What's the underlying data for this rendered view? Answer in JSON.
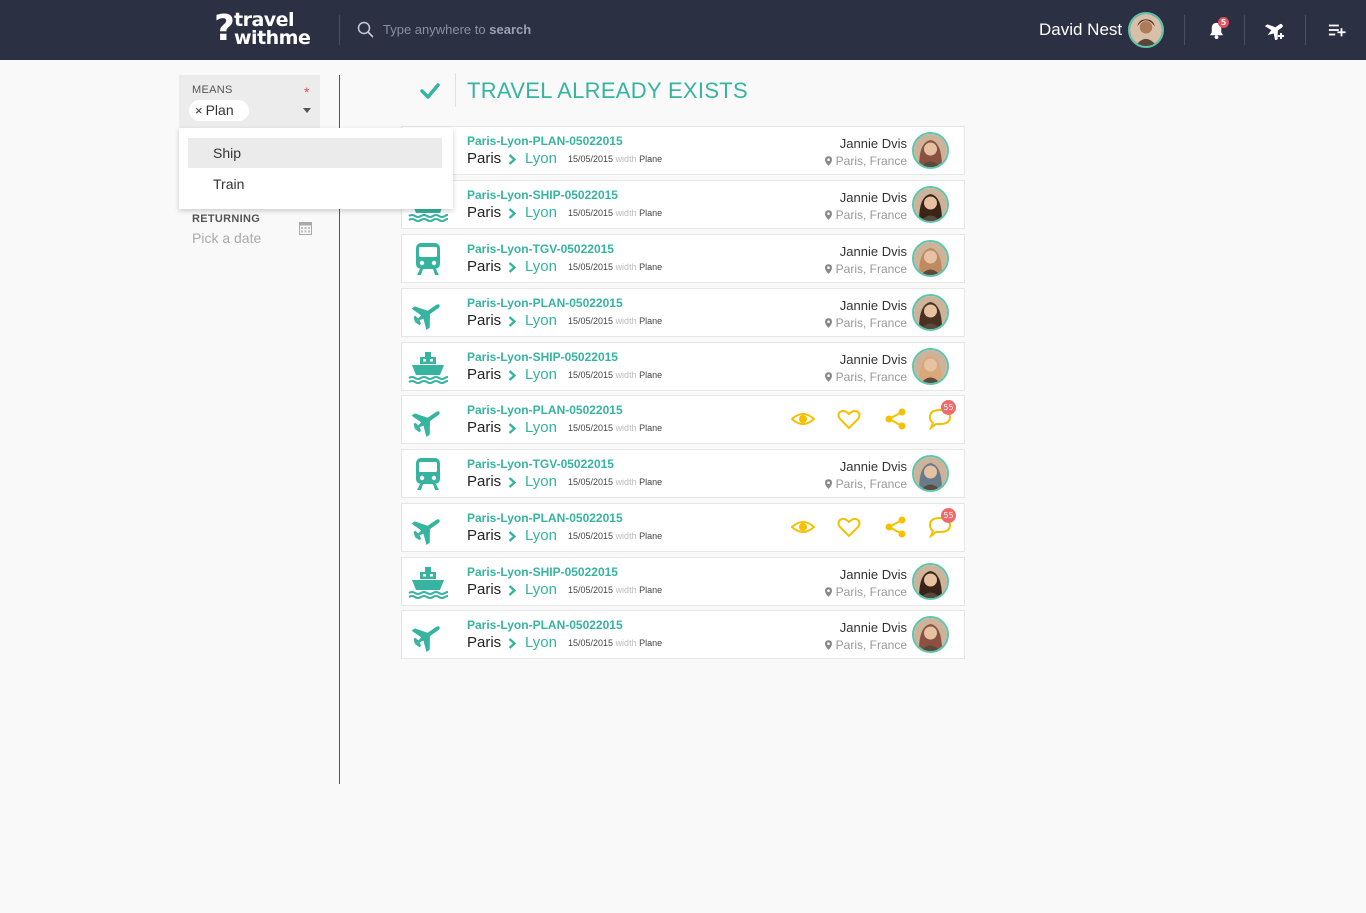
{
  "app": {
    "logo_mark": "?",
    "logo_line1": "travel",
    "logo_line2": "withme",
    "search_placeholder_pre": "Type anywhere to",
    "search_placeholder_em": "search",
    "user_name": "David Nest",
    "notification_count": "5",
    "accent_color": "#36b4a0",
    "topbar_color": "#2c3043",
    "icons": [
      "search-icon",
      "bell-icon",
      "plane-plus-icon",
      "add-list-icon"
    ]
  },
  "filters": {
    "means_label": "MEANS",
    "required_mark": "*",
    "selected_chip": "Plan",
    "chip_remove": "×",
    "options": [
      "Ship",
      "Train"
    ],
    "highlighted_option": "Ship",
    "returning_label": "RETURNING",
    "returning_placeholder": "Pick a date"
  },
  "main": {
    "title": "TRAVEL ALREADY EXISTS",
    "travels": [
      {
        "type": "plane",
        "code": "Paris-Lyon-PLAN-05022015",
        "from": "Paris",
        "to": "Lyon",
        "date": "15/05/2015",
        "with_label": "width",
        "means": "Plane",
        "user": "Jannie Dvis",
        "location": "Paris, France",
        "avatar_tone": "#8a5040",
        "view": "user"
      },
      {
        "type": "ship",
        "code": "Paris-Lyon-SHIP-05022015",
        "from": "Paris",
        "to": "Lyon",
        "date": "15/05/2015",
        "with_label": "width",
        "means": "Plane",
        "user": "Jannie Dvis",
        "location": "Paris, France",
        "avatar_tone": "#3a2418",
        "view": "user"
      },
      {
        "type": "train",
        "code": "Paris-Lyon-TGV-05022015",
        "from": "Paris",
        "to": "Lyon",
        "date": "15/05/2015",
        "with_label": "width",
        "means": "Plane",
        "user": "Jannie Dvis",
        "location": "Paris, France",
        "avatar_tone": "#c08a60",
        "view": "user"
      },
      {
        "type": "plane",
        "code": "Paris-Lyon-PLAN-05022015",
        "from": "Paris",
        "to": "Lyon",
        "date": "15/05/2015",
        "with_label": "width",
        "means": "Plane",
        "user": "Jannie Dvis",
        "location": "Paris, France",
        "avatar_tone": "#4a3022",
        "view": "user"
      },
      {
        "type": "ship",
        "code": "Paris-Lyon-SHIP-05022015",
        "from": "Paris",
        "to": "Lyon",
        "date": "15/05/2015",
        "with_label": "width",
        "means": "Plane",
        "user": "Jannie Dvis",
        "location": "Paris, France",
        "avatar_tone": "#d9a77a",
        "view": "user"
      },
      {
        "type": "plane",
        "code": "Paris-Lyon-PLAN-05022015",
        "from": "Paris",
        "to": "Lyon",
        "date": "15/05/2015",
        "with_label": "width",
        "means": "Plane",
        "comments": "55",
        "view": "actions"
      },
      {
        "type": "train",
        "code": "Paris-Lyon-TGV-05022015",
        "from": "Paris",
        "to": "Lyon",
        "date": "15/05/2015",
        "with_label": "width",
        "means": "Plane",
        "user": "Jannie Dvis",
        "location": "Paris, France",
        "avatar_tone": "#6a7a8a",
        "view": "user"
      },
      {
        "type": "plane",
        "code": "Paris-Lyon-PLAN-05022015",
        "from": "Paris",
        "to": "Lyon",
        "date": "15/05/2015",
        "with_label": "width",
        "means": "Plane",
        "comments": "55",
        "view": "actions"
      },
      {
        "type": "ship",
        "code": "Paris-Lyon-SHIP-05022015",
        "from": "Paris",
        "to": "Lyon",
        "date": "15/05/2015",
        "with_label": "width",
        "means": "Plane",
        "user": "Jannie Dvis",
        "location": "Paris, France",
        "avatar_tone": "#3a2418",
        "view": "user"
      },
      {
        "type": "plane",
        "code": "Paris-Lyon-PLAN-05022015",
        "from": "Paris",
        "to": "Lyon",
        "date": "15/05/2015",
        "with_label": "width",
        "means": "Plane",
        "user": "Jannie Dvis",
        "location": "Paris, France",
        "avatar_tone": "#8a5040",
        "view": "user"
      }
    ]
  }
}
